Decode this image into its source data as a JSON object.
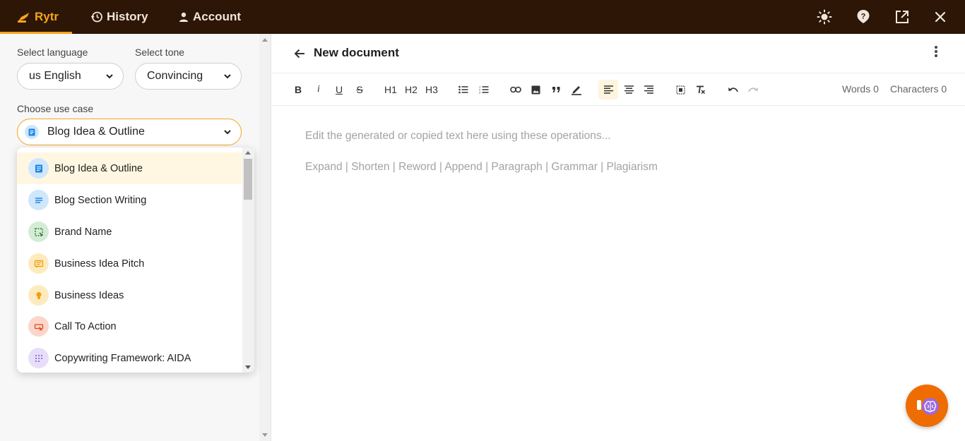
{
  "nav": {
    "tabs": [
      {
        "label": "Rytr",
        "icon": "rytr-logo-icon"
      },
      {
        "label": "History",
        "icon": "history-icon"
      },
      {
        "label": "Account",
        "icon": "account-icon"
      }
    ],
    "right_icons": [
      "theme-sun-icon",
      "help-icon",
      "open-external-icon",
      "close-icon"
    ]
  },
  "left": {
    "language_label": "Select language",
    "language_value": "us English",
    "tone_label": "Select tone",
    "tone_value": "Convincing",
    "usecase_label": "Choose use case",
    "usecase_value": "Blog Idea & Outline"
  },
  "dropdown": {
    "items": [
      {
        "label": "Blog Idea & Outline",
        "icon": "document-icon",
        "color": "#1e88e5",
        "bg": "#cfe6fb"
      },
      {
        "label": "Blog Section Writing",
        "icon": "lines-icon",
        "color": "#1e88e5",
        "bg": "#cfe6fb"
      },
      {
        "label": "Brand Name",
        "icon": "select-box-icon",
        "color": "#2e7d32",
        "bg": "#d4ecd5"
      },
      {
        "label": "Business Idea Pitch",
        "icon": "message-icon",
        "color": "#f59e0b",
        "bg": "#fdebc0"
      },
      {
        "label": "Business Ideas",
        "icon": "lightbulb-icon",
        "color": "#f59e0b",
        "bg": "#fdebc0"
      },
      {
        "label": "Call To Action",
        "icon": "cursor-click-icon",
        "color": "#e64a19",
        "bg": "#fbd6ca"
      },
      {
        "label": "Copywriting Framework: AIDA",
        "icon": "grid-dots-icon",
        "color": "#7e57c2",
        "bg": "#e7defa"
      }
    ]
  },
  "doc": {
    "title": "New document",
    "words": "Words 0",
    "characters": "Characters 0",
    "placeholder_line1": "Edit the generated or copied text here using these operations...",
    "placeholder_line2": "Expand | Shorten | Reword | Append | Paragraph | Grammar | Plagiarism"
  },
  "toolbar": {
    "bold": "B",
    "italic": "i",
    "underline": "U",
    "strike": "S",
    "h1": "H1",
    "h2": "H2",
    "h3": "H3"
  },
  "colors": {
    "accent": "#f5a51c",
    "topbar": "#2d1605",
    "fab": "#ef6c00"
  }
}
